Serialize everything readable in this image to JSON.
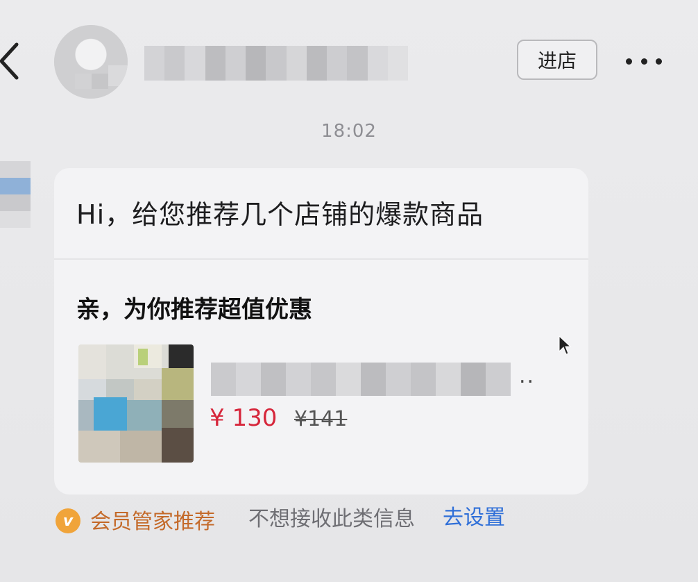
{
  "header": {
    "enter_shop_label": "进店"
  },
  "chat": {
    "timestamp": "18:02",
    "greeting": "Hi，给您推荐几个店铺的爆款商品",
    "promo_title": "亲，为你推荐超值优惠",
    "product": {
      "title_suffix": "..",
      "price_current": "¥ 130",
      "price_original": "¥141"
    }
  },
  "footer": {
    "member_label": "会员管家推荐",
    "optout_text": "不想接收此类信息",
    "settings_link": "去设置",
    "badge_letter": "v"
  },
  "colors": {
    "price": "#d6263b",
    "link": "#2f6fd8",
    "member": "#c46a2a",
    "badge": "#f0a43a"
  },
  "icons": [
    "back-icon",
    "more-icon",
    "member-badge-icon",
    "cursor-icon"
  ]
}
